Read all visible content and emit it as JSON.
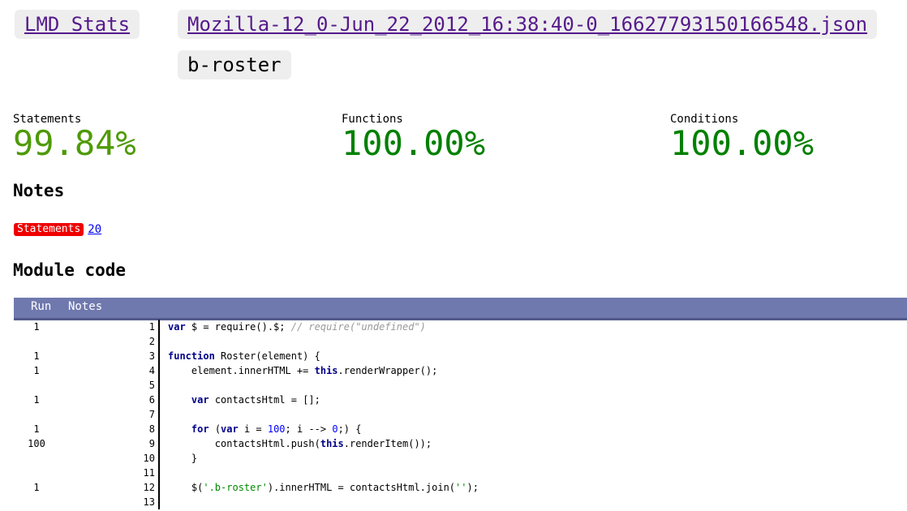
{
  "breadcrumbs": {
    "home": "LMD Stats",
    "file": "Mozilla-12_0-Jun_22_2012_16:38:40-0_16627793150166548.json",
    "module": "b-roster"
  },
  "metrics": [
    {
      "label": "Statements",
      "value": "99.84%",
      "color": "#4e9a06"
    },
    {
      "label": "Functions",
      "value": "100.00%",
      "color": "#008000"
    },
    {
      "label": "Conditions",
      "value": "100.00%",
      "color": "#008000"
    }
  ],
  "notes": {
    "heading": "Notes",
    "badge": "Statements",
    "link": "20"
  },
  "module": {
    "heading": "Module code",
    "columns": {
      "run": "Run",
      "notes": "Notes"
    },
    "lines": [
      {
        "run": "1",
        "ln": "1",
        "tokens": [
          {
            "t": "kw",
            "v": "var"
          },
          {
            "t": "p",
            "v": " $ = require().$; "
          },
          {
            "t": "cm",
            "v": "// require(\"undefined\")"
          }
        ]
      },
      {
        "run": "",
        "ln": "2",
        "tokens": []
      },
      {
        "run": "1",
        "ln": "3",
        "tokens": [
          {
            "t": "kw",
            "v": "function"
          },
          {
            "t": "p",
            "v": " Roster(element) {"
          }
        ]
      },
      {
        "run": "1",
        "ln": "4",
        "tokens": [
          {
            "t": "p",
            "v": "    element.innerHTML += "
          },
          {
            "t": "kw",
            "v": "this"
          },
          {
            "t": "p",
            "v": ".renderWrapper();"
          }
        ]
      },
      {
        "run": "",
        "ln": "5",
        "tokens": []
      },
      {
        "run": "1",
        "ln": "6",
        "tokens": [
          {
            "t": "p",
            "v": "    "
          },
          {
            "t": "kw",
            "v": "var"
          },
          {
            "t": "p",
            "v": " contactsHtml = [];"
          }
        ]
      },
      {
        "run": "",
        "ln": "7",
        "tokens": []
      },
      {
        "run": "1",
        "ln": "8",
        "tokens": [
          {
            "t": "p",
            "v": "    "
          },
          {
            "t": "kw",
            "v": "for"
          },
          {
            "t": "p",
            "v": " ("
          },
          {
            "t": "kw",
            "v": "var"
          },
          {
            "t": "p",
            "v": " i = "
          },
          {
            "t": "nm",
            "v": "100"
          },
          {
            "t": "p",
            "v": "; i --> "
          },
          {
            "t": "nm",
            "v": "0"
          },
          {
            "t": "p",
            "v": ";) {"
          }
        ]
      },
      {
        "run": "100",
        "ln": "9",
        "tokens": [
          {
            "t": "p",
            "v": "        contactsHtml.push("
          },
          {
            "t": "kw",
            "v": "this"
          },
          {
            "t": "p",
            "v": ".renderItem());"
          }
        ]
      },
      {
        "run": "",
        "ln": "10",
        "tokens": [
          {
            "t": "p",
            "v": "    }"
          }
        ]
      },
      {
        "run": "",
        "ln": "11",
        "tokens": []
      },
      {
        "run": "1",
        "ln": "12",
        "tokens": [
          {
            "t": "p",
            "v": "    $("
          },
          {
            "t": "st",
            "v": "'.b-roster'"
          },
          {
            "t": "p",
            "v": ").innerHTML = contactsHtml.join("
          },
          {
            "t": "st",
            "v": "''"
          },
          {
            "t": "p",
            "v": ");"
          }
        ]
      },
      {
        "run": "",
        "ln": "13",
        "tokens": []
      }
    ]
  }
}
